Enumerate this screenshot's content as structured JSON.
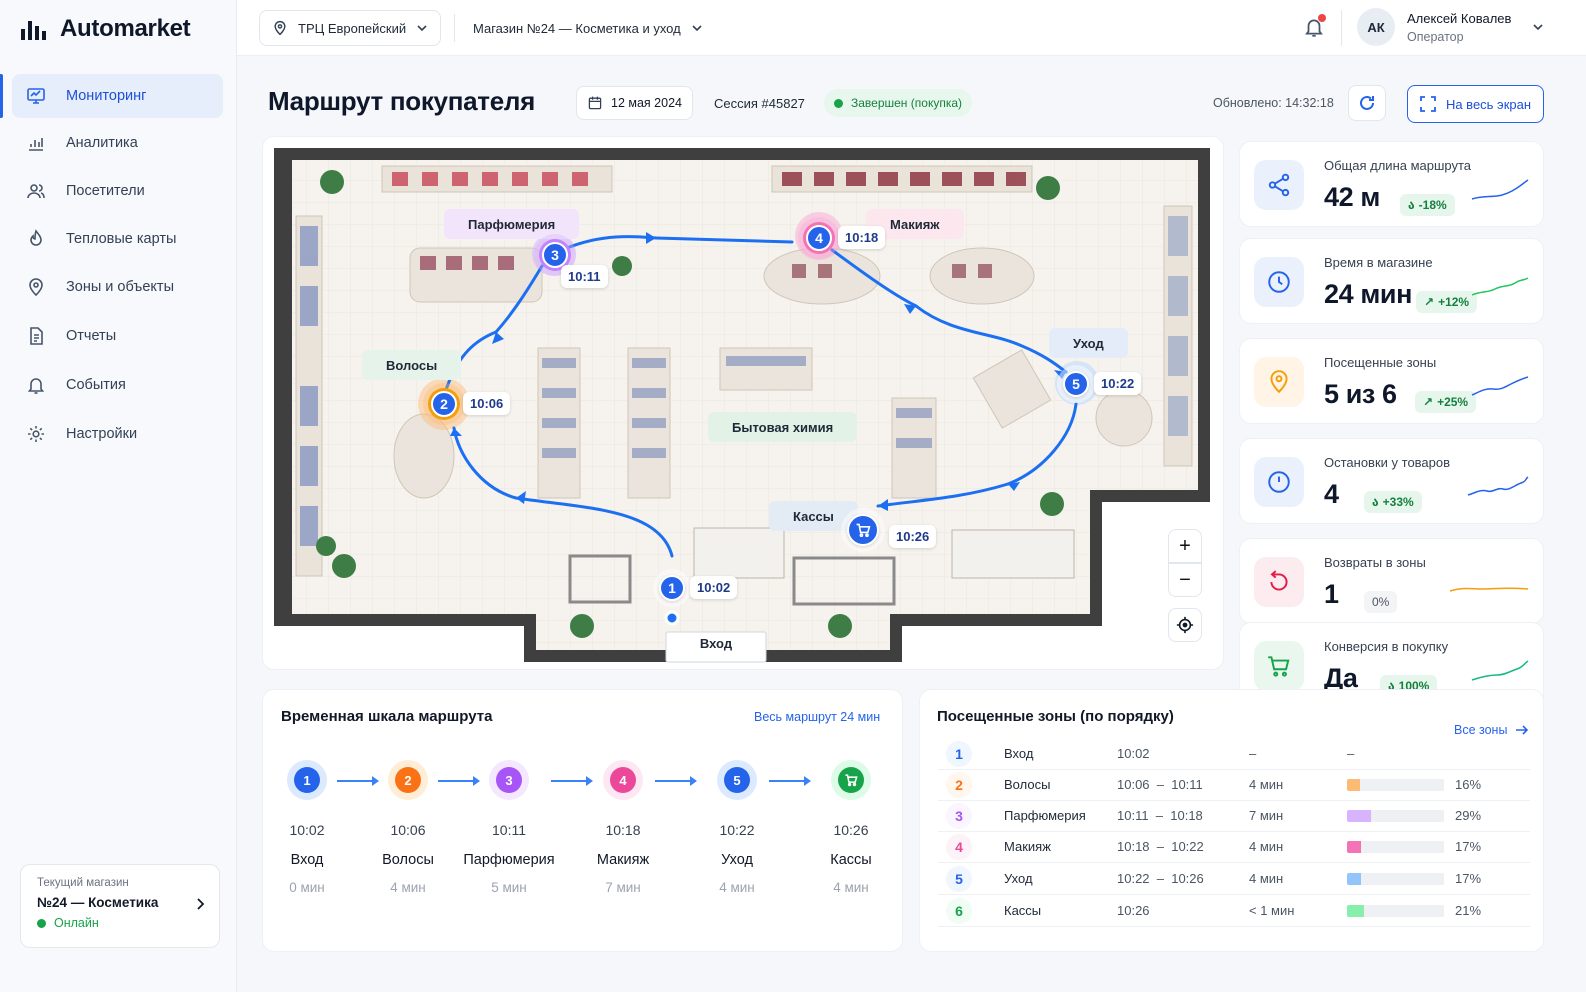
{
  "app": {
    "name": "Automarket"
  },
  "topbar": {
    "mall": "ТРЦ Европейский",
    "store": "Магазин №24 — Косметика и уход",
    "user_initials": "АК",
    "user_name": "Алексей Ковалев",
    "user_role": "Оператор"
  },
  "sidebar": {
    "items": [
      {
        "label": "Мониторинг",
        "icon": "monitor-icon",
        "active": true
      },
      {
        "label": "Аналитика",
        "icon": "bar-chart-icon"
      },
      {
        "label": "Посетители",
        "icon": "users-icon"
      },
      {
        "label": "Тепловые карты",
        "icon": "heatmap-icon"
      },
      {
        "label": "Зоны и объекты",
        "icon": "location-pin-icon"
      },
      {
        "label": "Отчеты",
        "icon": "report-icon"
      },
      {
        "label": "События",
        "icon": "bell-icon"
      },
      {
        "label": "Настройки",
        "icon": "gear-icon"
      }
    ],
    "store_card": {
      "caption": "Текущий магазин",
      "name": "№24 — Косметика",
      "status": "Онлайн"
    }
  },
  "header": {
    "title": "Маршрут покупателя",
    "date": "12 мая 2024",
    "session": "Сессия #45827",
    "status": "Завершен (покупка)",
    "updated": "Обновлено: 14:32:18",
    "fullscreen": "На весь экран"
  },
  "map": {
    "zones": {
      "perfume": "Парфюмерия",
      "makeup": "Макияж",
      "hair": "Волосы",
      "care": "Уход",
      "household": "Бытовая химия",
      "checkout": "Кассы",
      "entrance": "Вход"
    },
    "points": [
      {
        "n": "1",
        "time": "10:02"
      },
      {
        "n": "2",
        "time": "10:06"
      },
      {
        "n": "3",
        "time": "10:11"
      },
      {
        "n": "4",
        "time": "10:18"
      },
      {
        "n": "5",
        "time": "10:22"
      },
      {
        "n": "cart",
        "time": "10:26"
      }
    ],
    "controls": {
      "zoom_in": "+",
      "zoom_out": "−"
    }
  },
  "stats": [
    {
      "label": "Общая длина маршрута",
      "value": "42 м",
      "badge": "-18%",
      "color": "#2563eb",
      "badge_color": "#16a34a"
    },
    {
      "label": "Время в магазине",
      "value": "24 мин",
      "badge": "+12%",
      "color": "#2563eb",
      "badge_color": "#16a34a"
    },
    {
      "label": "Посещенные зоны",
      "value": "5 из 6",
      "badge": "+25%",
      "color": "#f59e0b",
      "badge_color": "#16a34a"
    },
    {
      "label": "Остановки у товаров",
      "value": "4",
      "badge": "+33%",
      "color": "#2563eb",
      "badge_color": "#16a34a"
    },
    {
      "label": "Возвраты в зоны",
      "value": "1",
      "badge": "0%",
      "color": "#e11d48",
      "badge_color": "#6b7280"
    },
    {
      "label": "Конверсия в покупку",
      "value": "Да",
      "badge": "100%",
      "color": "#16a34a",
      "badge_color": "#16a34a"
    }
  ],
  "timeline": {
    "title": "Временная шкала маршрута",
    "link": "Весь маршрут 24 мин",
    "steps": [
      {
        "n": "1",
        "time": "10:02",
        "name": "Вход",
        "dur": "0 мин",
        "color": "#2563eb",
        "bg": "#dbeafe"
      },
      {
        "n": "2",
        "time": "10:06",
        "name": "Волосы",
        "dur": "4 мин",
        "color": "#f97316",
        "bg": "#ffedd5"
      },
      {
        "n": "3",
        "time": "10:11",
        "name": "Парфюмерия",
        "dur": "5 мин",
        "color": "#a855f7",
        "bg": "#f3e8ff"
      },
      {
        "n": "4",
        "time": "10:18",
        "name": "Макияж",
        "dur": "7 мин",
        "color": "#ec4899",
        "bg": "#fce7f3"
      },
      {
        "n": "5",
        "time": "10:22",
        "name": "Уход",
        "dur": "4 мин",
        "color": "#2563eb",
        "bg": "#dbeafe"
      },
      {
        "n": "",
        "time": "10:26",
        "name": "Кассы",
        "dur": "4 мин",
        "color": "#16a34a",
        "bg": "#dcfce7"
      }
    ]
  },
  "zones_table": {
    "title": "Посещенные зоны (по порядку)",
    "link": "Все зоны",
    "rows": [
      {
        "n": "1",
        "name": "Вход",
        "time": "10:02",
        "dur": "–",
        "pct": "–",
        "share": 0,
        "color": "#2563eb",
        "bg": "#eff6ff"
      },
      {
        "n": "2",
        "name": "Волосы",
        "time": "10:06  –  10:11",
        "dur": "4 мин",
        "pct": "16%",
        "share": 0.16,
        "color": "#f97316",
        "bg": "#fff7ed",
        "bar": "#fdba74"
      },
      {
        "n": "3",
        "name": "Парфюмерия",
        "time": "10:11  –  10:18",
        "dur": "7 мин",
        "pct": "29%",
        "share": 0.29,
        "color": "#a855f7",
        "bg": "#faf5ff",
        "bar": "#d8b4fe"
      },
      {
        "n": "4",
        "name": "Макияж",
        "time": "10:18  –  10:22",
        "dur": "4 мин",
        "pct": "17%",
        "share": 0.17,
        "color": "#ec4899",
        "bg": "#fdf2f8",
        "bar": "#f472b6"
      },
      {
        "n": "5",
        "name": "Уход",
        "time": "10:22  –  10:26",
        "dur": "4 мин",
        "pct": "17%",
        "share": 0.17,
        "color": "#2563eb",
        "bg": "#eff6ff",
        "bar": "#93c5fd"
      },
      {
        "n": "6",
        "name": "Кассы",
        "time": "10:26",
        "dur": "< 1 мин",
        "pct": "21%",
        "share": 0.21,
        "color": "#16a34a",
        "bg": "#f0fdf4",
        "bar": "#86efac"
      }
    ]
  }
}
